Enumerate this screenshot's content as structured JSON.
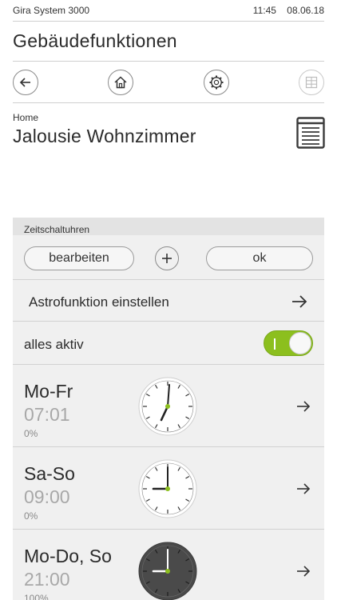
{
  "statusbar": {
    "app_name": "Gira System 3000",
    "time": "11:45",
    "date": "08.06.18"
  },
  "header": {
    "title": "Gebäudefunktionen"
  },
  "nav": [
    {
      "name": "back-button",
      "icon": "back-arrow-icon",
      "enabled": true
    },
    {
      "name": "home-button",
      "icon": "home-icon",
      "enabled": true
    },
    {
      "name": "settings-button",
      "icon": "gear-icon",
      "enabled": true
    },
    {
      "name": "grid-button",
      "icon": "grid-icon",
      "enabled": false
    }
  ],
  "device": {
    "breadcrumb": "Home",
    "title": "Jalousie Wohnzimmer",
    "icon": "blind-icon"
  },
  "timers": {
    "header": "Zeitschaltuhren",
    "edit_label": "bearbeiten",
    "add_icon": "plus-icon",
    "ok_label": "ok",
    "astro_label": "Astrofunktion einstellen",
    "all_active_label": "alles aktiv",
    "all_active_on": true,
    "items": [
      {
        "days": "Mo-Fr",
        "time": "07:01",
        "value": "0%",
        "clock_style": "light"
      },
      {
        "days": "Sa-So",
        "time": "09:00",
        "value": "0%",
        "clock_style": "light"
      },
      {
        "days": "Mo-Do, So",
        "time": "21:00",
        "value": "100%",
        "clock_style": "dark"
      }
    ]
  },
  "colors": {
    "accent": "#8cbf1e",
    "panel": "#f0f0f0",
    "clock_dark": "#4a4a4a"
  }
}
